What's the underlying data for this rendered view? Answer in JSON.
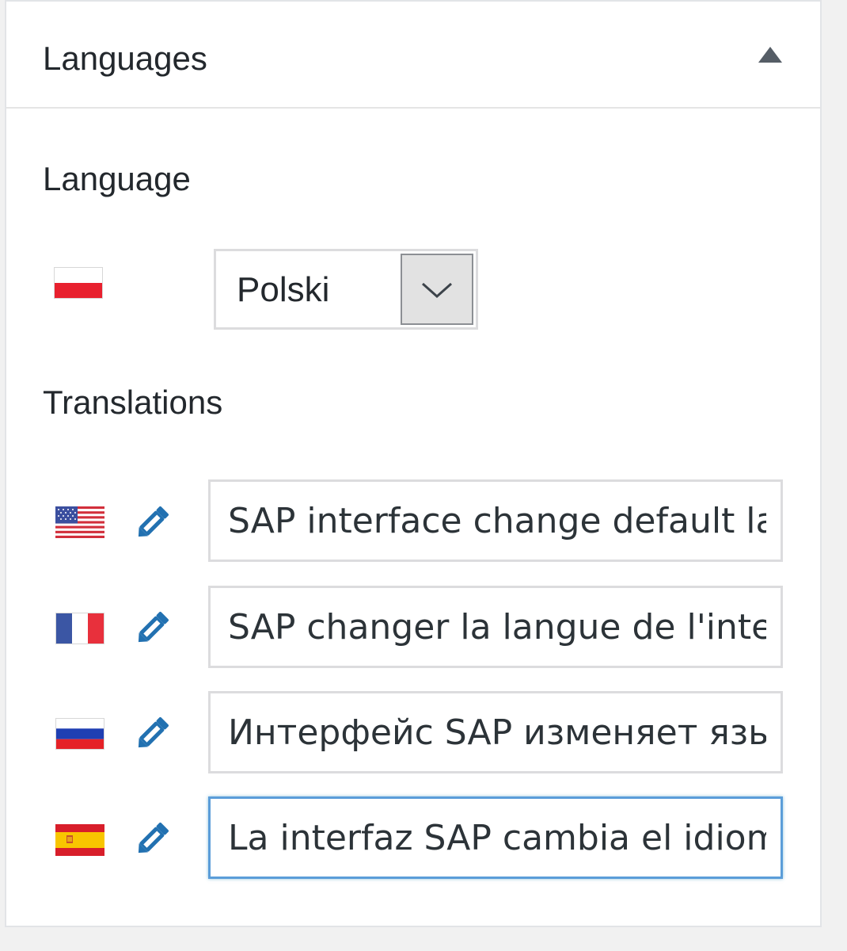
{
  "panel": {
    "title": "Languages",
    "toggle_icon": "triangle-up-icon"
  },
  "language": {
    "label": "Language",
    "flag": "flag-pl-icon",
    "selected": "Polski",
    "dropdown_icon": "chevron-down-icon"
  },
  "translations": {
    "label": "Translations",
    "items": [
      {
        "flag": "flag-us-icon",
        "edit_icon": "pencil-icon",
        "value": "SAP interface change default language"
      },
      {
        "flag": "flag-fr-icon",
        "edit_icon": "pencil-icon",
        "value": "SAP changer la langue de l'interface"
      },
      {
        "flag": "flag-ru-icon",
        "edit_icon": "pencil-icon",
        "value": "Интерфейс SAP изменяет язык"
      },
      {
        "flag": "flag-es-icon",
        "edit_icon": "pencil-icon",
        "value": "La interfaz SAP cambia el idioma"
      }
    ]
  },
  "colors": {
    "accent_blue": "#2271b1",
    "focus_border": "#5b9dd9",
    "panel_border": "#e2e4e7"
  }
}
